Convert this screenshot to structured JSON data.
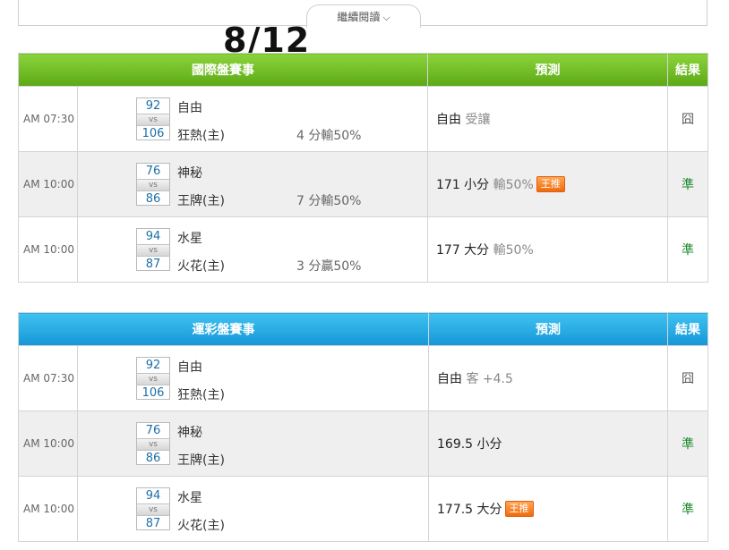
{
  "continue_reading": "繼續閱讀",
  "date": "8/12",
  "tables": [
    {
      "header": {
        "main": "國際盤賽事",
        "pred": "預測",
        "res": "結果"
      },
      "rows": [
        {
          "time": "AM 07:30",
          "score_a": "92",
          "score_b": "106",
          "vs": "vs",
          "team_a": "自由",
          "team_b": "狂熱(主)",
          "handicap": "4 分輸50%",
          "pred_main": "自由",
          "pred_sub": "受讓",
          "badge": "",
          "result": "囧"
        },
        {
          "time": "AM 10:00",
          "score_a": "76",
          "score_b": "86",
          "vs": "vs",
          "team_a": "神秘",
          "team_b": "王牌(主)",
          "handicap": "7 分輸50%",
          "pred_main": "171 小分",
          "pred_sub": "輸50%",
          "badge": "王推",
          "result": "準"
        },
        {
          "time": "AM 10:00",
          "score_a": "94",
          "score_b": "87",
          "vs": "vs",
          "team_a": "水星",
          "team_b": "火花(主)",
          "handicap": "3 分贏50%",
          "pred_main": "177 大分",
          "pred_sub": "輸50%",
          "badge": "",
          "result": "準"
        }
      ]
    },
    {
      "header": {
        "main": "運彩盤賽事",
        "pred": "預測",
        "res": "結果"
      },
      "rows": [
        {
          "time": "AM 07:30",
          "score_a": "92",
          "score_b": "106",
          "vs": "vs",
          "team_a": "自由",
          "team_b": "狂熱(主)",
          "handicap": "",
          "pred_main": "自由",
          "pred_sub": "客 +4.5",
          "badge": "",
          "result": "囧"
        },
        {
          "time": "AM 10:00",
          "score_a": "76",
          "score_b": "86",
          "vs": "vs",
          "team_a": "神秘",
          "team_b": "王牌(主)",
          "handicap": "",
          "pred_main": "169.5 小分",
          "pred_sub": "",
          "badge": "",
          "result": "準"
        },
        {
          "time": "AM 10:00",
          "score_a": "94",
          "score_b": "87",
          "vs": "vs",
          "team_a": "水星",
          "team_b": "火花(主)",
          "handicap": "",
          "pred_main": "177.5 大分",
          "pred_sub": "",
          "badge": "王推",
          "result": "準"
        }
      ]
    }
  ]
}
